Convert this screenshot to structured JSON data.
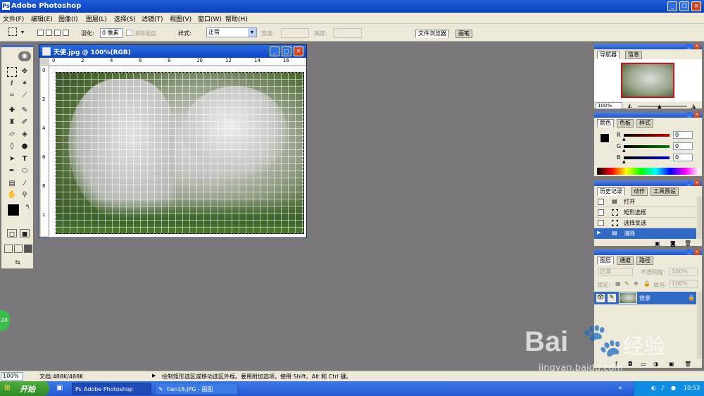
{
  "app": {
    "title": "Adobe Photoshop",
    "icon_letter": "Ps"
  },
  "window_buttons": {
    "minimize": "_",
    "restore": "❐",
    "close": "✕"
  },
  "menu": [
    "文件(F)",
    "编辑(E)",
    "图像(I)",
    "图层(L)",
    "选择(S)",
    "滤镜(T)",
    "视图(V)",
    "窗口(W)",
    "帮助(H)"
  ],
  "options": {
    "feather_label": "羽化:",
    "feather_value": "0 像素",
    "antialias_label": "消除锯齿",
    "style_label": "样式:",
    "style_value": "正常",
    "width_label": "宽度:",
    "height_label": "高度:",
    "tabs": [
      "文件浏览器",
      "画笔"
    ]
  },
  "document": {
    "title": "天使.jpg @ 100%(RGB)",
    "ruler_top": [
      "0",
      "2",
      "4",
      "6",
      "8",
      "10",
      "12",
      "14",
      "16"
    ],
    "ruler_left": [
      "0",
      "2",
      "4",
      "6",
      "8",
      "1"
    ]
  },
  "navigator": {
    "tabs": [
      "导航器",
      "信息"
    ],
    "zoom": "100%"
  },
  "color_panel": {
    "tabs": [
      "颜色",
      "色板",
      "样式"
    ],
    "channels": [
      {
        "label": "R",
        "value": "0",
        "color": "#c00000"
      },
      {
        "label": "G",
        "value": "0",
        "color": "#008000"
      },
      {
        "label": "B",
        "value": "0",
        "color": "#0000c0"
      }
    ]
  },
  "history": {
    "tabs": [
      "历史记录",
      "动作",
      "工具预设"
    ],
    "items": [
      "打开",
      "矩形选框",
      "选择反选",
      "清除"
    ]
  },
  "layers": {
    "tabs": [
      "图层",
      "通道",
      "路径"
    ],
    "blend_mode": "正常",
    "opacity_label": "不透明度:",
    "opacity_value": "100%",
    "lock_label": "锁定:",
    "fill_label": "填充:",
    "fill_value": "100%",
    "layer_name": "背景"
  },
  "status": {
    "zoom": "100%",
    "doc_info": "文档:488K/488K",
    "hint": "绘制矩形选区或移动选区外框。要用附加选项，使用 Shift、Alt 和 Ctrl 键。"
  },
  "side_badge": "24",
  "taskbar": {
    "start": "开始",
    "tasks": [
      "Adobe Photoshop",
      "tian18.JPG - 画图"
    ],
    "clock": "10:53"
  },
  "watermark": {
    "brand": "Bai",
    "brand_cn": "经验",
    "url": "jingyan.baidu.com"
  }
}
